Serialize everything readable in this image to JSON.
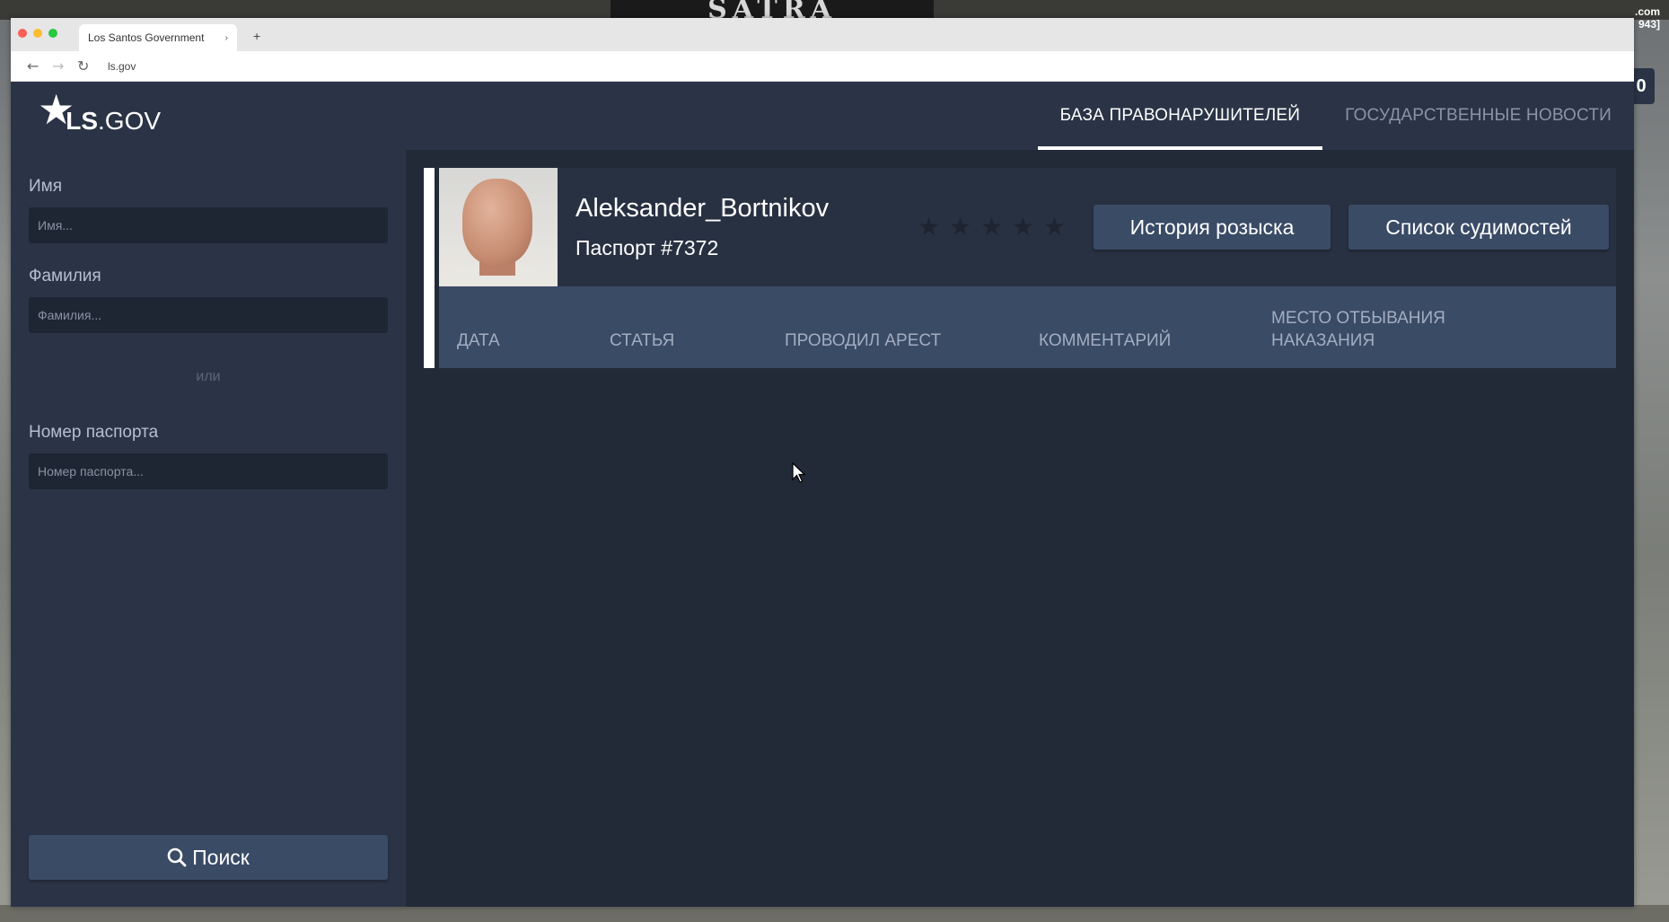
{
  "browser": {
    "tab_title": "Los Santos Government",
    "tab_close": "›",
    "new_tab": "+",
    "url": "ls.gov",
    "back_icon": "←",
    "forward_icon": "→",
    "reload_icon": "↻"
  },
  "game_overlay": {
    "sign_text": "SATRA",
    "hud_value": "0",
    "hud_logo": ".com",
    "hud_logo_sub": "943]"
  },
  "site": {
    "logo_star": "★",
    "logo_ls": "LS",
    "logo_gov": ".GOV",
    "nav": {
      "tab_offenders": "БАЗА ПРАВОНАРУШИТЕЛЕЙ",
      "tab_news": "ГОСУДАРСТВЕННЫЕ НОВОСТИ"
    }
  },
  "sidebar": {
    "name_label": "Имя",
    "name_placeholder": "Имя...",
    "surname_label": "Фамилия",
    "surname_placeholder": "Фамилия...",
    "or_text": "или",
    "passport_label": "Номер паспорта",
    "passport_placeholder": "Номер паспорта...",
    "search_label": "Поиск"
  },
  "profile": {
    "name": "Aleksander_Bortnikov",
    "passport": "Паспорт #7372",
    "wanted_stars": 0,
    "wanted_max": 5,
    "history_button": "История розыска",
    "convictions_button": "Список судимостей"
  },
  "table": {
    "headers": [
      "ДАТА",
      "СТАТЬЯ",
      "ПРОВОДИЛ АРЕСТ",
      "КОММЕНТАРИЙ",
      "МЕСТО ОТБЫВАНИЯ НАКАЗАНИЯ"
    ]
  },
  "colors": {
    "panel": "#2b3446",
    "background": "#222a38",
    "button": "#3a4b66",
    "accent": "#ffffff"
  }
}
